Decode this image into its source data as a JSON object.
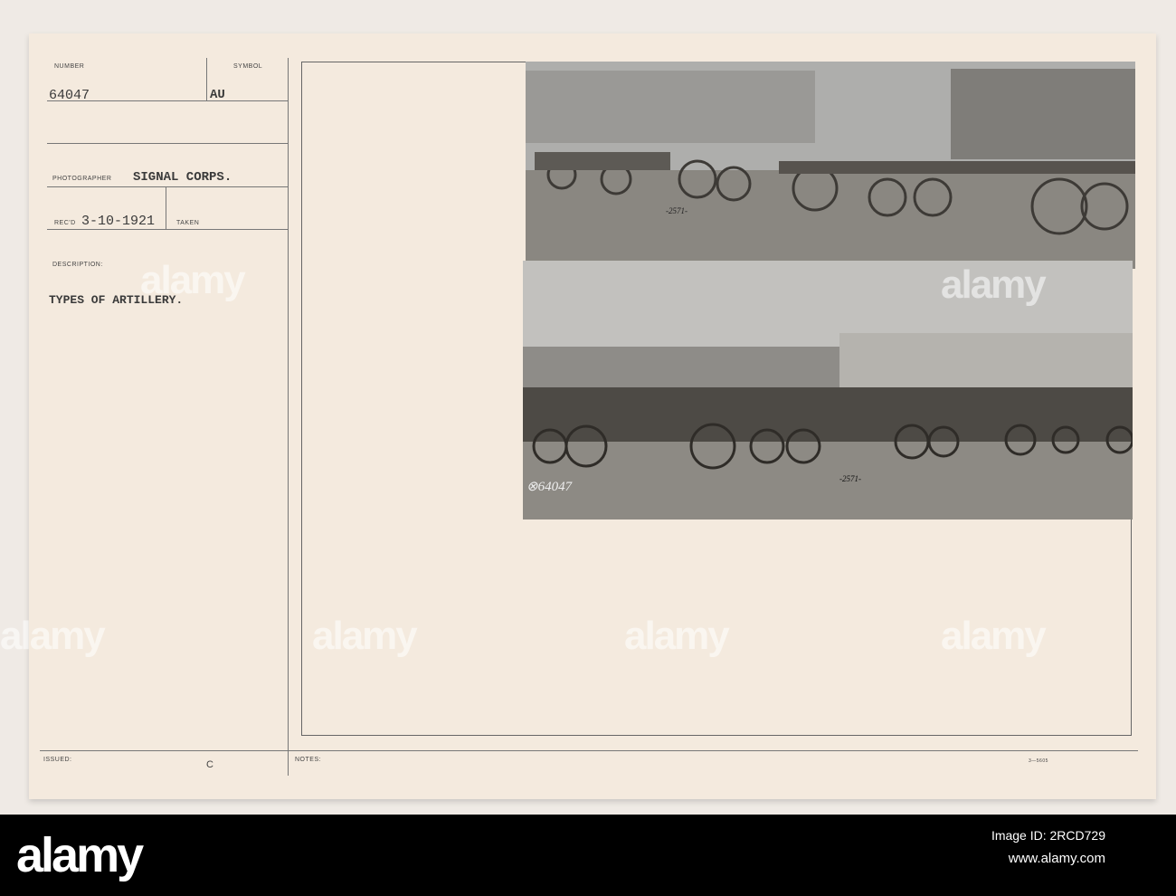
{
  "card": {
    "number_label": "NUMBER",
    "number": "64047",
    "symbol_label": "SYMBOL",
    "symbol": "AU",
    "photographer_label": "PHOTOGRAPHER",
    "photographer": "SIGNAL CORPS.",
    "recd_label": "REC'D",
    "recd": "3-10-1921",
    "taken_label": "TAKEN",
    "description_label": "DESCRIPTION:",
    "description": "TYPES OF ARTILLERY.",
    "issued_label": "ISSUED:",
    "issued": "C",
    "notes_label": "NOTES:",
    "form_number": "3—5605"
  },
  "photos": {
    "top_caption": "-2571-",
    "bottom_caption": "-2571-",
    "bottom_stamp": "⊗64047"
  },
  "watermark": "alamy",
  "footer": {
    "logo": "alamy",
    "image_id": "Image ID: 2RCD729",
    "url": "www.alamy.com"
  }
}
